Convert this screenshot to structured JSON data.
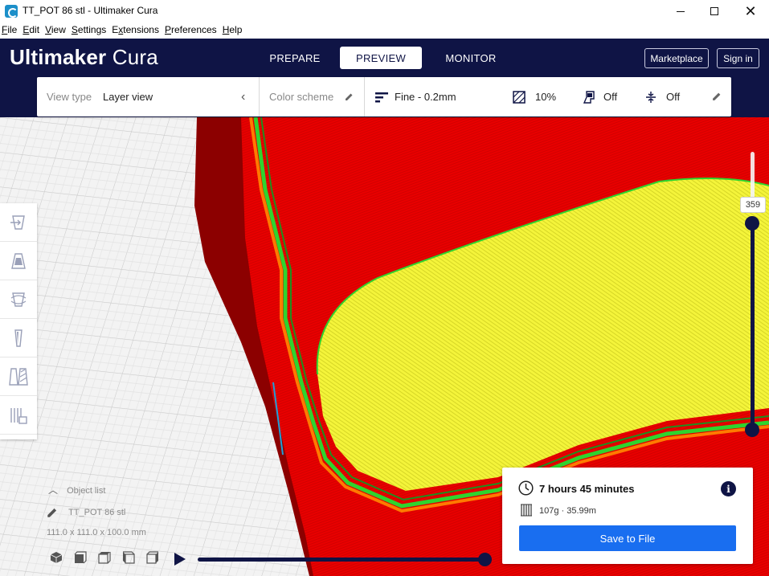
{
  "window": {
    "title": "TT_POT 86 stl - Ultimaker Cura",
    "controls": [
      "minimize",
      "maximize",
      "close"
    ]
  },
  "menu": [
    {
      "label": "File",
      "accel": "F",
      "rest": "ile"
    },
    {
      "label": "Edit",
      "accel": "E",
      "rest": "dit"
    },
    {
      "label": "View",
      "accel": "V",
      "rest": "iew"
    },
    {
      "label": "Settings",
      "accel": "S",
      "rest": "ettings"
    },
    {
      "label": "Extensions",
      "accel": "x",
      "rest": "tensions",
      "prefix": "E"
    },
    {
      "label": "Preferences",
      "accel": "P",
      "rest": "references"
    },
    {
      "label": "Help",
      "accel": "H",
      "rest": "elp"
    }
  ],
  "header": {
    "brand_bold": "Ultimaker",
    "brand_light": "Cura",
    "tabs": [
      {
        "label": "PREPARE",
        "active": false
      },
      {
        "label": "PREVIEW",
        "active": true
      },
      {
        "label": "MONITOR",
        "active": false
      }
    ],
    "marketplace_label": "Marketplace",
    "signin_label": "Sign in"
  },
  "viewbar": {
    "view_type_label": "View type",
    "view_type_value": "Layer view",
    "color_scheme_label": "Color scheme",
    "profile": "Fine - 0.2mm",
    "infill": "10%",
    "support": "Off",
    "adhesion": "Off"
  },
  "layer_slider": {
    "current_layer": "359"
  },
  "object_list": {
    "toggle_label": "Object list",
    "object_name": "TT_POT 86 stl",
    "dimensions": "111.0 x 111.0 x 100.0 mm"
  },
  "print_info": {
    "time": "7 hours 45 minutes",
    "material": "107g · 35.99m",
    "save_label": "Save to File"
  },
  "colors": {
    "header_bg": "#0f1445",
    "save_button": "#196ef0",
    "walls": "#ff0000",
    "infill": "#f2f22e",
    "shell": "#32c832",
    "bg_grid": "#f3f3f3"
  },
  "tools": [
    "move-icon",
    "scale-icon",
    "rotate-icon",
    "mirror-icon",
    "per-model-settings-icon",
    "support-blocker-icon"
  ]
}
